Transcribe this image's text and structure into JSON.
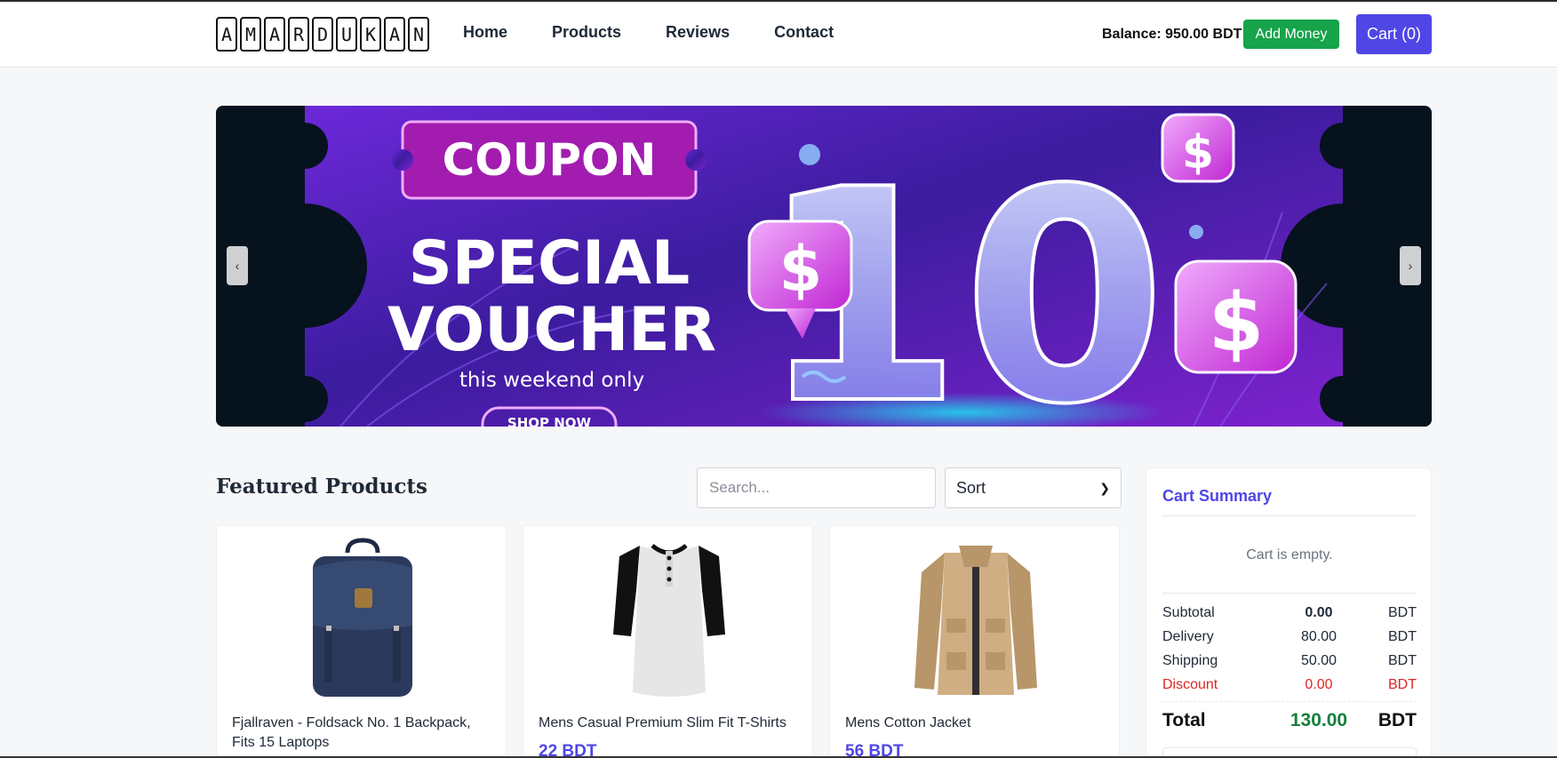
{
  "navbar": {
    "logo_letters": [
      "A",
      "M",
      "A",
      "R",
      "D",
      "U",
      "K",
      "A",
      "N"
    ],
    "links": [
      "Home",
      "Products",
      "Reviews",
      "Contact"
    ],
    "balance_text": "Balance: 950.00 BDT",
    "add_money_label": "Add Money",
    "cart_label": "Cart (0)"
  },
  "banner": {
    "prev_label": "‹",
    "next_label": "›",
    "coupon_text": "COUPON",
    "headline_1": "SPECIAL",
    "headline_2": "VOUCHER",
    "subline": "this weekend only",
    "big_number": "10",
    "cta_text": "SHOP NOW",
    "currency_symbol": "$",
    "colors": {
      "purple": "#7c2bd9",
      "pink": "#d946ef",
      "dark": "#06121e"
    }
  },
  "featured": {
    "title": "Featured Products",
    "search_placeholder": "Search...",
    "sort_label": "Sort"
  },
  "products": [
    {
      "name": "Fjallraven - Foldsack No. 1 Backpack, Fits 15 Laptops",
      "price": "",
      "image": "backpack-image"
    },
    {
      "name": "Mens Casual Premium Slim Fit T-Shirts",
      "price": "22 BDT",
      "image": "tshirt-image"
    },
    {
      "name": "Mens Cotton Jacket",
      "price": "56 BDT",
      "image": "jacket-image"
    }
  ],
  "cart_summary": {
    "title": "Cart Summary",
    "empty_text": "Cart is empty.",
    "rows": [
      {
        "label": "Subtotal",
        "value": "0.00",
        "currency": "BDT"
      },
      {
        "label": "Delivery",
        "value": "80.00",
        "currency": "BDT"
      },
      {
        "label": "Shipping",
        "value": "50.00",
        "currency": "BDT"
      },
      {
        "label": "Discount",
        "value": "0.00",
        "currency": "BDT"
      }
    ],
    "total": {
      "label": "Total",
      "value": "130.00",
      "currency": "BDT"
    }
  },
  "colors": {
    "accent": "#4f46e5",
    "success": "#16a34a",
    "danger": "#dc2626",
    "total_green": "#15803d"
  }
}
